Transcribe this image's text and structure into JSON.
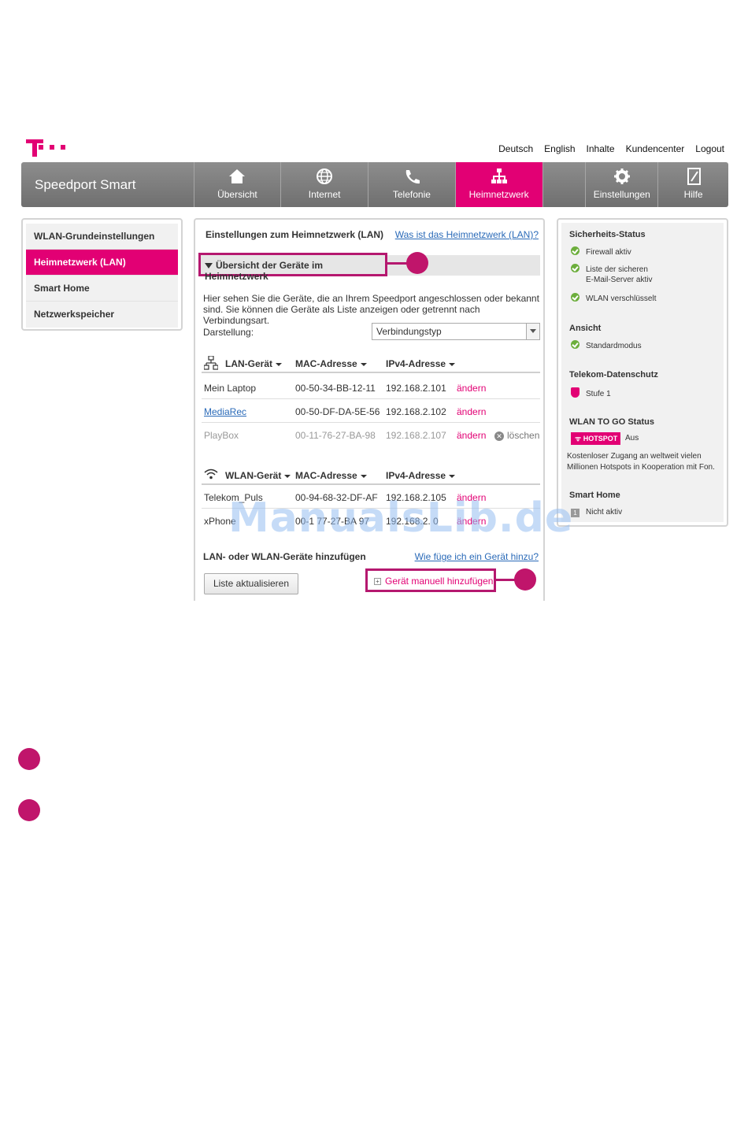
{
  "header": {
    "links": [
      "Deutsch",
      "English",
      "Inhalte",
      "Kundencenter",
      "Logout"
    ],
    "brand": "Speedport Smart"
  },
  "nav": [
    {
      "label": "Übersicht",
      "icon": "home-icon"
    },
    {
      "label": "Internet",
      "icon": "globe-icon"
    },
    {
      "label": "Telefonie",
      "icon": "phone-icon"
    },
    {
      "label": "Heimnetzwerk",
      "icon": "network-icon",
      "active": true
    },
    {
      "label": "Einstellungen",
      "icon": "gear-icon"
    },
    {
      "label": "Hilfe",
      "icon": "help-book-icon"
    }
  ],
  "sidebar": {
    "items": [
      {
        "label": "WLAN-Grundeinstellungen"
      },
      {
        "label": "Heimnetzwerk (LAN)",
        "active": true
      },
      {
        "label": "Smart Home"
      },
      {
        "label": "Netzwerkspeicher"
      }
    ]
  },
  "main": {
    "title": "Einstellungen zum Heimnetzwerk (LAN)",
    "help_link": "Was ist das Heimnetzwerk (LAN)?",
    "section": "Übersicht der Geräte im Heimnetzwerk",
    "description": "Hier sehen Sie die Geräte, die an Ihrem Speedport angeschlossen oder bekannt sind. Sie können die Geräte als Liste anzeigen oder getrennt nach Verbindungsart.",
    "display_label": "Darstellung:",
    "display_value": "Verbindungstyp",
    "lan_table": {
      "headers": [
        "LAN-Gerät",
        "MAC-Adresse",
        "IPv4-Adresse"
      ],
      "rows": [
        {
          "name": "Mein Laptop",
          "mac": "00-50-34-BB-12-11",
          "ip": "192.168.2.101",
          "action": "ändern"
        },
        {
          "name": "MediaRec",
          "mac": "00-50-DF-DA-5E-56",
          "ip": "192.168.2.102",
          "action": "ändern"
        },
        {
          "name": "PlayBox",
          "mac": "00-11-76-27-BA-98",
          "ip": "192.168.2.107",
          "action": "ändern",
          "delete": "löschen"
        }
      ]
    },
    "wlan_table": {
      "headers": [
        "WLAN-Gerät",
        "MAC-Adresse",
        "IPv4-Adresse"
      ],
      "rows": [
        {
          "name": "Telekom_Puls",
          "mac": "00-94-68-32-DF-AF",
          "ip": "192.168.2.105",
          "action": "ändern"
        },
        {
          "name": "xPhone",
          "mac": "00-1 77-27-BA 97",
          "ip": "192.168.2. 0",
          "action": "ändern"
        }
      ]
    },
    "add_label": "LAN- oder WLAN-Geräte hinzufügen",
    "add_help": "Wie füge ich ein Gerät hinzu?",
    "refresh_button": "Liste aktualisieren",
    "manual_add": "Gerät manuell hinzufügen"
  },
  "status": {
    "security_title": "Sicherheits-Status",
    "firewall": "Firewall aktiv",
    "mailserver_1": "Liste der sicheren",
    "mailserver_2": "E-Mail-Server aktiv",
    "wlan": "WLAN verschlüsselt",
    "view_title": "Ansicht",
    "view_mode": "Standardmodus",
    "privacy_title": "Telekom-Datenschutz",
    "privacy_level": "Stufe 1",
    "togo_title": "WLAN TO GO Status",
    "hotspot": "HOTSPOT",
    "hotspot_state": "Aus",
    "togo_desc_1": "Kostenloser Zugang an weltweit vielen",
    "togo_desc_2": "Millionen Hotspots in Kooperation mit Fon.",
    "smarthome_title": "Smart Home",
    "smarthome_state": "Nicht aktiv"
  },
  "watermark": "ManualsLib.de",
  "colors": {
    "accent": "#e20074",
    "callout": "#b5186f",
    "nav": "#7f7f7f",
    "link": "#2a6ab8"
  }
}
